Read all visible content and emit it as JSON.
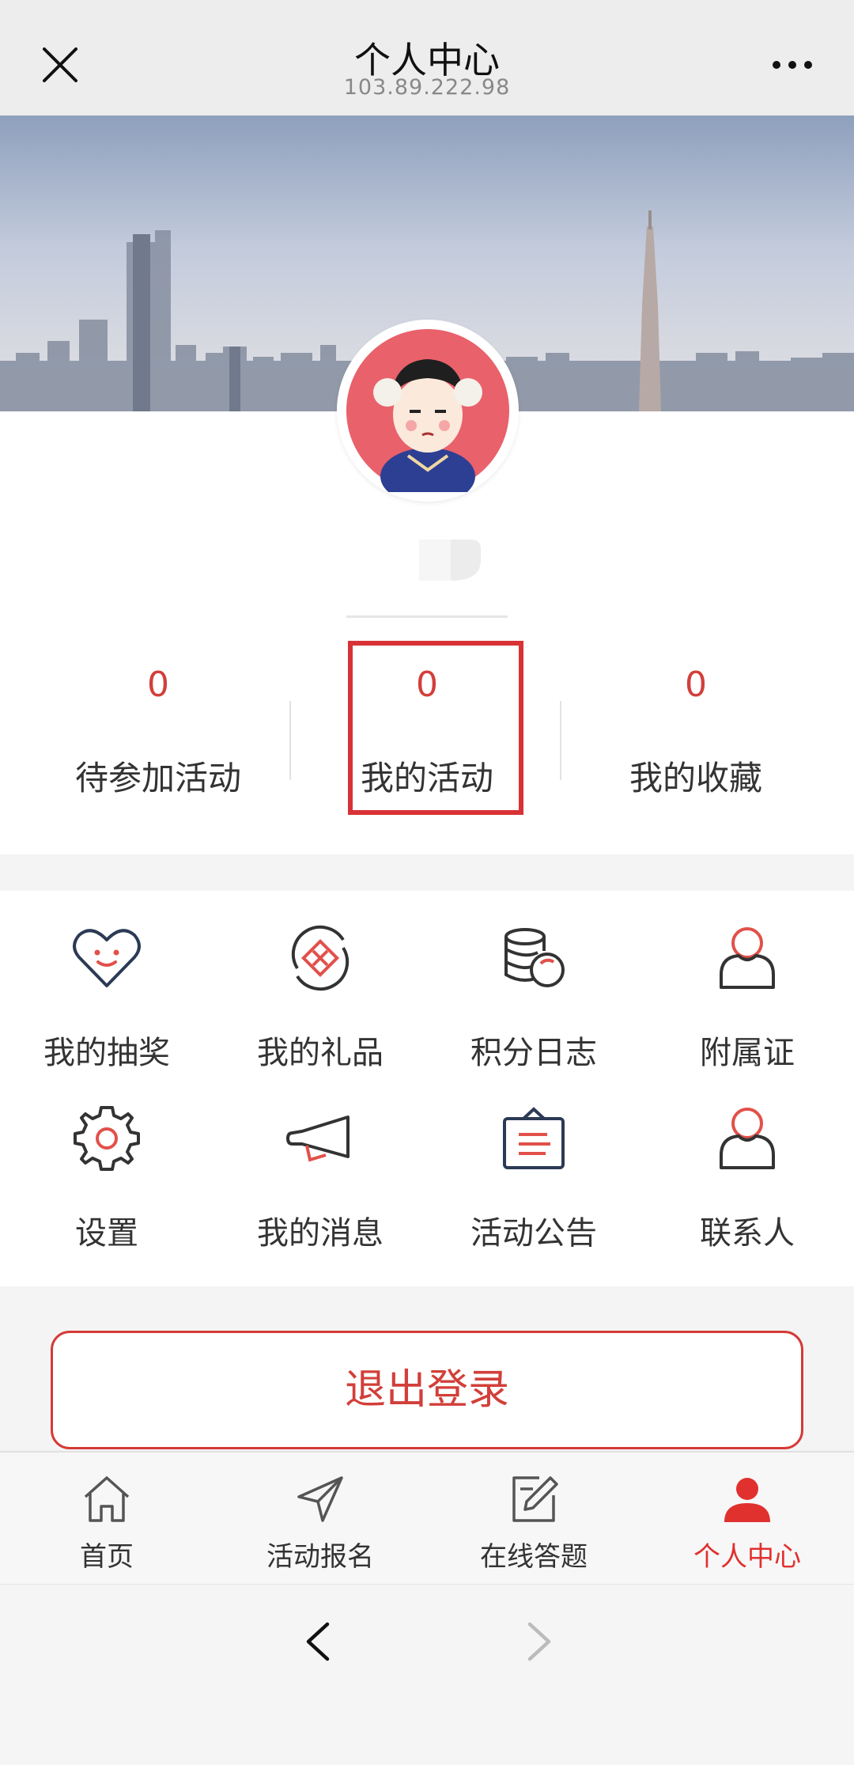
{
  "header": {
    "title": "个人中心",
    "url": "103.89.222.98"
  },
  "stats": [
    {
      "value": "0",
      "label": "待参加活动"
    },
    {
      "value": "0",
      "label": "我的活动"
    },
    {
      "value": "0",
      "label": "我的收藏"
    }
  ],
  "menu": [
    {
      "label": "我的抽奖",
      "icon": "heart-smile-icon"
    },
    {
      "label": "我的礼品",
      "icon": "gift-icon"
    },
    {
      "label": "积分日志",
      "icon": "coins-icon"
    },
    {
      "label": "附属证",
      "icon": "person-icon"
    },
    {
      "label": "设置",
      "icon": "gear-icon"
    },
    {
      "label": "我的消息",
      "icon": "megaphone-icon"
    },
    {
      "label": "活动公告",
      "icon": "notice-board-icon"
    },
    {
      "label": "联系人",
      "icon": "contact-icon"
    }
  ],
  "logout_label": "退出登录",
  "tabs": [
    {
      "label": "首页",
      "icon": "home-icon"
    },
    {
      "label": "活动报名",
      "icon": "send-icon"
    },
    {
      "label": "在线答题",
      "icon": "edit-icon"
    },
    {
      "label": "个人中心",
      "icon": "user-icon",
      "active": true
    }
  ],
  "colors": {
    "accent": "#d23f3a",
    "dark_icon": "#2b3a55"
  }
}
